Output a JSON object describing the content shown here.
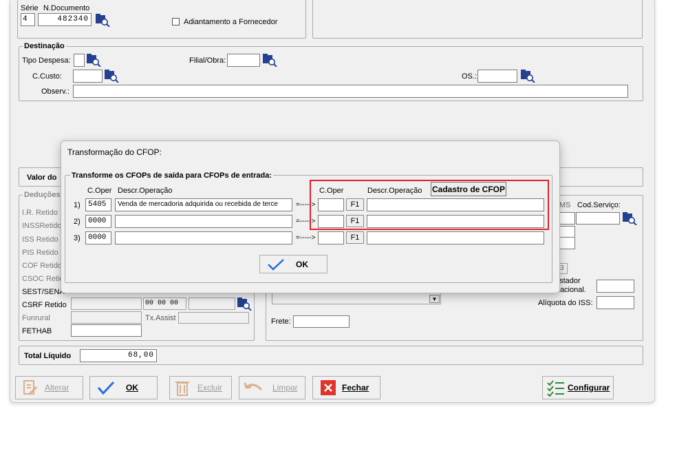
{
  "header": {
    "serie_label": "Série",
    "serie_value": "4",
    "ndoc_label": "N.Documento",
    "ndoc_value": "482340",
    "adiantamento_label": "Adiantamento a Fornecedor"
  },
  "destinacao": {
    "title": "Destinação",
    "tipo_despesa_label": "Tipo Despesa:",
    "filial_label": "Filial/Obra:",
    "ccusto_label": "C.Custo:",
    "os_label": "OS.:",
    "observ_label": "Observ.:"
  },
  "valor_title": "Valor do",
  "deducoes": {
    "title": "Deduções",
    "rows": [
      "I.R. Retido",
      "INSSRetido",
      "ISS Retido",
      "PIS Retido",
      "COF Retido",
      "CSOC Retido",
      "SEST/SENA",
      "CSRF Retido",
      "Funrural",
      "FETHAB"
    ],
    "time_value": "00 00 00",
    "tx_assist_label": "Tx.Assist"
  },
  "right_panel": {
    "ms_label": "MS",
    "cod_servico_label": "Cod.Serviço:",
    "prestador_label": "estador",
    "nacional_label": "Nacional.",
    "aliquota_label": "Alíquota do ISS:",
    "frete_label": "Frete:",
    "partial_value": "3"
  },
  "total": {
    "label": "Total Líquido",
    "value": "68,00"
  },
  "toolbar": {
    "alterar": "Alterar",
    "ok": "OK",
    "excluir": "Excluir",
    "limpar": "Limpar",
    "fechar": "Fechar",
    "configurar": "Configurar"
  },
  "dialog": {
    "title": "Transformação do CFOP:",
    "group_title": "Transforme os CFOPs de saída para CFOPs de entrada:",
    "col_coper": "C.Oper",
    "col_descr": "Descr.Operação",
    "col_coper_right": "C.Oper",
    "col_descr_right": "Descr.Operação",
    "cadastro_button": "Cadastro de CFOP",
    "arrow_text": "=----->",
    "f1_label": "F1",
    "ok_label": "OK",
    "rows": [
      {
        "num": "1)",
        "coper": "5405",
        "descr": "Venda de mercadoria adquirida ou recebida de terce",
        "coper_in": "",
        "descr_in": ""
      },
      {
        "num": "2)",
        "coper": "0000",
        "descr": "",
        "coper_in": "",
        "descr_in": ""
      },
      {
        "num": "3)",
        "coper": "0000",
        "descr": "",
        "coper_in": "",
        "descr_in": ""
      }
    ]
  },
  "colors": {
    "highlight": "#e0202a",
    "accent": "#2a6fd6",
    "fechar_red": "#e0352b",
    "configurar_green": "#2e8b3a"
  }
}
